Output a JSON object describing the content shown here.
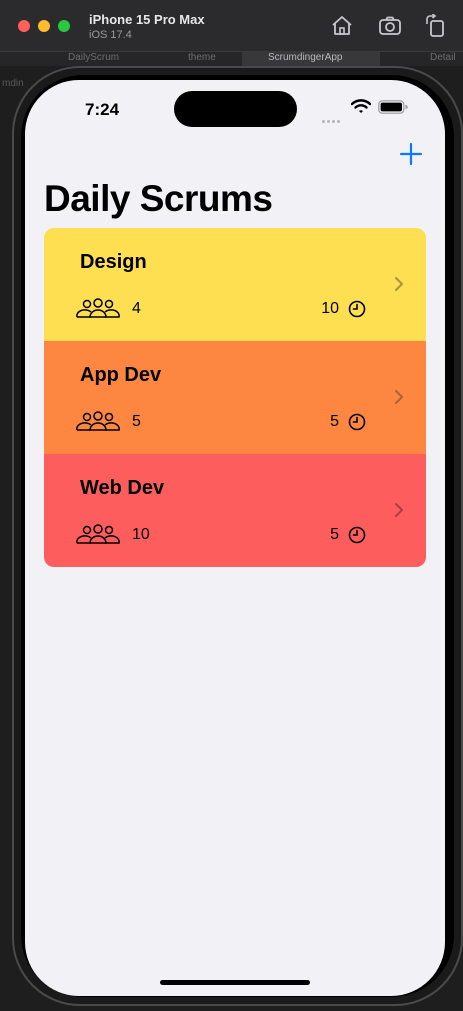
{
  "simulator": {
    "device_name": "iPhone 15 Pro Max",
    "os_version": "iOS 17.4",
    "home_icon": "home-icon",
    "screenshot_icon": "camera-icon",
    "rotate_icon": "rotate-icon"
  },
  "xcode": {
    "tabs": [
      "DailyScrum",
      "theme",
      "ScrumdingerApp",
      "Detail"
    ],
    "active_tab": "ScrumdingerApp",
    "partial_text": "mdin"
  },
  "status_bar": {
    "time": "7:24",
    "wifi_icon": "wifi-icon",
    "battery_icon": "battery-icon"
  },
  "nav": {
    "title": "Daily Scrums",
    "add_icon": "plus-icon",
    "accent_color": "#0a7aff"
  },
  "scrums": [
    {
      "title": "Design",
      "attendees": "4",
      "length": "10",
      "color": "#fedf52"
    },
    {
      "title": "App Dev",
      "attendees": "5",
      "length": "5",
      "color": "#fd8741"
    },
    {
      "title": "Web Dev",
      "attendees": "10",
      "length": "5",
      "color": "#fe5d5e"
    }
  ]
}
